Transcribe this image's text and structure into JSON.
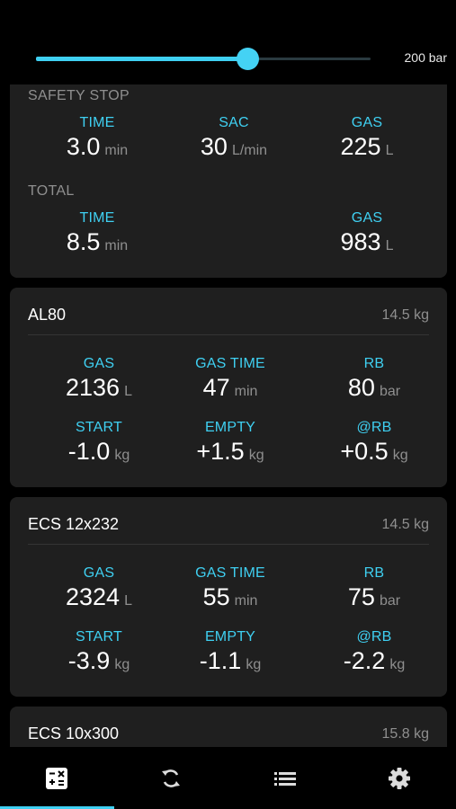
{
  "slider": {
    "value_label": "200 bar",
    "fill_fraction": 0.632
  },
  "summary": {
    "safety_stop": {
      "title": "SAFETY STOP",
      "time": {
        "label": "TIME",
        "value": "3.0",
        "unit": "min"
      },
      "sac": {
        "label": "SAC",
        "value": "30",
        "unit": "L/min"
      },
      "gas": {
        "label": "GAS",
        "value": "225",
        "unit": "L"
      }
    },
    "total": {
      "title": "TOTAL",
      "time": {
        "label": "TIME",
        "value": "8.5",
        "unit": "min"
      },
      "gas": {
        "label": "GAS",
        "value": "983",
        "unit": "L"
      }
    }
  },
  "tanks": [
    {
      "name": "AL80",
      "weight": "14.5 kg",
      "gas": {
        "label": "GAS",
        "value": "2136",
        "unit": "L"
      },
      "gas_time": {
        "label": "GAS TIME",
        "value": "47",
        "unit": "min"
      },
      "rb": {
        "label": "RB",
        "value": "80",
        "unit": "bar"
      },
      "start": {
        "label": "START",
        "value": "-1.0",
        "unit": "kg"
      },
      "empty": {
        "label": "EMPTY",
        "value": "+1.5",
        "unit": "kg"
      },
      "at_rb": {
        "label": "@RB",
        "value": "+0.5",
        "unit": "kg"
      }
    },
    {
      "name": "ECS 12x232",
      "weight": "14.5 kg",
      "gas": {
        "label": "GAS",
        "value": "2324",
        "unit": "L"
      },
      "gas_time": {
        "label": "GAS TIME",
        "value": "55",
        "unit": "min"
      },
      "rb": {
        "label": "RB",
        "value": "75",
        "unit": "bar"
      },
      "start": {
        "label": "START",
        "value": "-3.9",
        "unit": "kg"
      },
      "empty": {
        "label": "EMPTY",
        "value": "-1.1",
        "unit": "kg"
      },
      "at_rb": {
        "label": "@RB",
        "value": "-2.2",
        "unit": "kg"
      }
    },
    {
      "name": "ECS 10x300",
      "weight": "15.8 kg"
    }
  ],
  "tabbar": {
    "active_index": 0,
    "tabs": [
      {
        "icon": "calculator-icon"
      },
      {
        "icon": "sync-icon"
      },
      {
        "icon": "list-icon"
      },
      {
        "icon": "gear-icon"
      }
    ]
  },
  "colors": {
    "accent": "#3fd0f2",
    "card": "#1f1f1f",
    "muted": "#8f8f8f",
    "background": "#000000"
  }
}
